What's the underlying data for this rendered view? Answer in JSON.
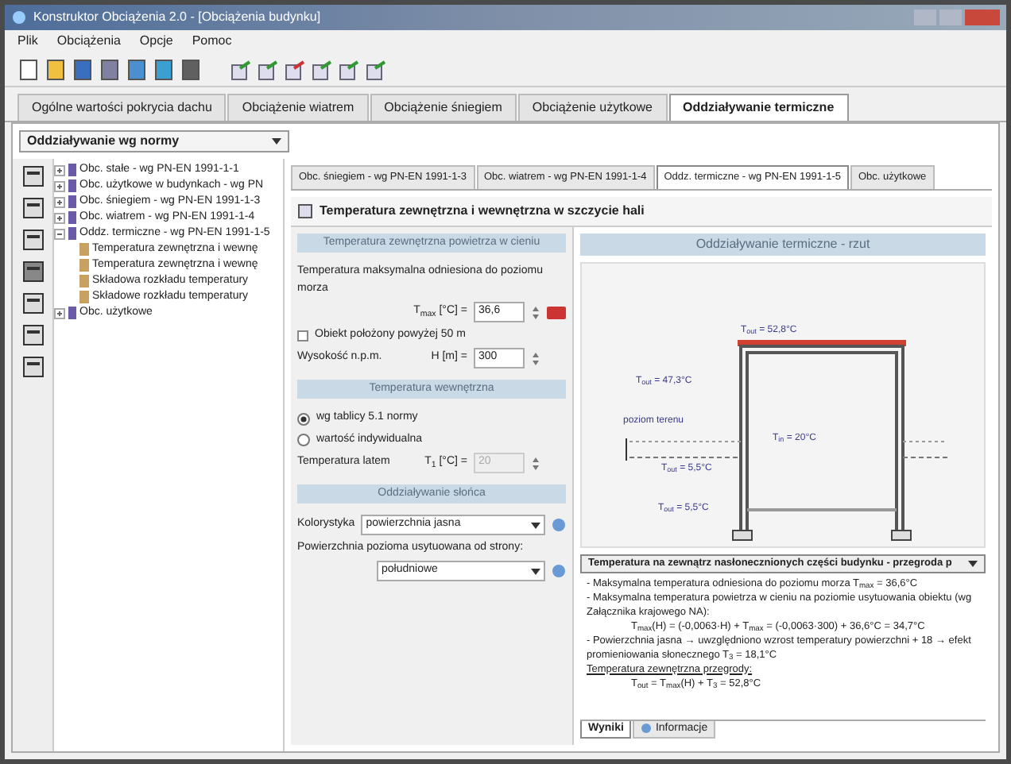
{
  "window": {
    "title": "Konstruktor Obciążenia 2.0 - [Obciążenia budynku]"
  },
  "menu": [
    "Plik",
    "Obciążenia",
    "Opcje",
    "Pomoc"
  ],
  "tabs": [
    {
      "label": "Ogólne wartości pokrycia dachu",
      "selected": false
    },
    {
      "label": "Obciążenie wiatrem",
      "selected": false
    },
    {
      "label": "Obciążenie śniegiem",
      "selected": false
    },
    {
      "label": "Obciążenie użytkowe",
      "selected": false
    },
    {
      "label": "Oddziaływanie termiczne",
      "selected": true
    }
  ],
  "norm_dropdown": {
    "value": "Oddziaływanie wg normy"
  },
  "tree": [
    {
      "label": "Obc. stałe - wg PN-EN 1991-1-1",
      "expanded": false
    },
    {
      "label": "Obc. użytkowe w budynkach - wg PN",
      "expanded": false
    },
    {
      "label": "Obc. śniegiem - wg PN-EN 1991-1-3",
      "expanded": false
    },
    {
      "label": "Obc. wiatrem - wg PN-EN 1991-1-4",
      "expanded": false
    },
    {
      "label": "Oddz. termiczne - wg PN-EN 1991-1-5",
      "expanded": true,
      "children": [
        {
          "label": "Temperatura zewnętrzna i wewnę"
        },
        {
          "label": "Temperatura zewnętrzna i wewnę"
        },
        {
          "label": "Składowa rozkładu temperatury"
        },
        {
          "label": "Składowe rozkładu temperatury"
        }
      ]
    },
    {
      "label": "Obc. użytkowe",
      "expanded": false
    }
  ],
  "subtabs": [
    {
      "label": "Obc. śniegiem - wg PN-EN 1991-1-3",
      "selected": false
    },
    {
      "label": "Obc. wiatrem - wg PN-EN 1991-1-4",
      "selected": false
    },
    {
      "label": "Oddz. termiczne - wg PN-EN 1991-1-5",
      "selected": true
    },
    {
      "label": "Obc. użytkowe",
      "selected": false
    }
  ],
  "panel_title": "Temperatura zewnętrzna i wewnętrzna w szczycie hali",
  "form": {
    "section_1": "Temperatura zewnętrzna powietrza w cieniu",
    "tmax_label": "Temperatura maksymalna odniesiona do poziomu morza",
    "tmax_symbol": "T$_{max}$ [°C] =",
    "tmax_value": "36,6",
    "above_50m": {
      "label": "Obiekt położony powyżej 50 m",
      "checked": false
    },
    "height_label": "Wysokość n.p.m.",
    "height_symbol": "H [m] =",
    "height_value": "300",
    "section_2": "Temperatura wewnętrzna",
    "radios": [
      {
        "label": "wg tablicy 5.1 normy",
        "selected": true
      },
      {
        "label": "wartość indywidualna",
        "selected": false
      }
    ],
    "t1_label": "Temperatura latem",
    "t1_symbol": "T$_{1}$ [°C] =",
    "t1_value": "20",
    "t1_disabled": true,
    "section_3": "Oddziaływanie słońca",
    "color_label": "Kolorystyka",
    "color_value": "powierzchnia jasna",
    "side_label": "Powierzchnia pozioma usytuowana od strony:",
    "side_value": "południowe"
  },
  "drawing": {
    "title": "Oddziaływanie termiczne - rzut",
    "labels": [
      {
        "text": "T$_{out}$ = 52,8°C",
        "kind": "top"
      },
      {
        "text": "T$_{out}$ = 47,3°C",
        "kind": "left"
      },
      {
        "text": "poziom terenu",
        "kind": "ground"
      },
      {
        "text": "T$_{out}$ = 5,5°C",
        "kind": "below"
      },
      {
        "text": "T$_{out}$ = 5,5°C",
        "kind": "bottom"
      },
      {
        "text": "T$_{in}$ = 20°C",
        "kind": "inside"
      }
    ]
  },
  "results": {
    "dropdown": "Temperatura na zewnątrz nasłonecznionych części budynku - przegroda p",
    "lines": [
      {
        "text": "- Maksymalna temperatura odniesiona do poziomu morza T$_{max}$ = 36,6°C",
        "kind": "plain"
      },
      {
        "text": "- Maksymalna temperatura powietrza w cieniu na poziomie usytuowania obiektu (wg Załącznika krajowego NA):",
        "kind": "plain"
      },
      {
        "text": "T$_{max}$(H) = (-0,0063·H) + T$_{max}$ = (-0,0063·300) + 36,6°C = 34,7°C",
        "kind": "formula"
      },
      {
        "text": "- Powierzchnia jasna → uwzględniono wzrost temperatury powierzchni + 18 → efekt promieniowania słonecznego T$_{3}$ = 18,1°C",
        "kind": "plain"
      },
      {
        "text": "Temperatura zewnętrzna przegrody:",
        "kind": "heading"
      },
      {
        "text": "T$_{out}$ = T$_{max}$(H) + T$_{3}$ = 52,8°C",
        "kind": "formula"
      }
    ],
    "tabs": [
      {
        "label": "Wyniki",
        "selected": true
      },
      {
        "label": "Informacje",
        "selected": false
      }
    ]
  }
}
